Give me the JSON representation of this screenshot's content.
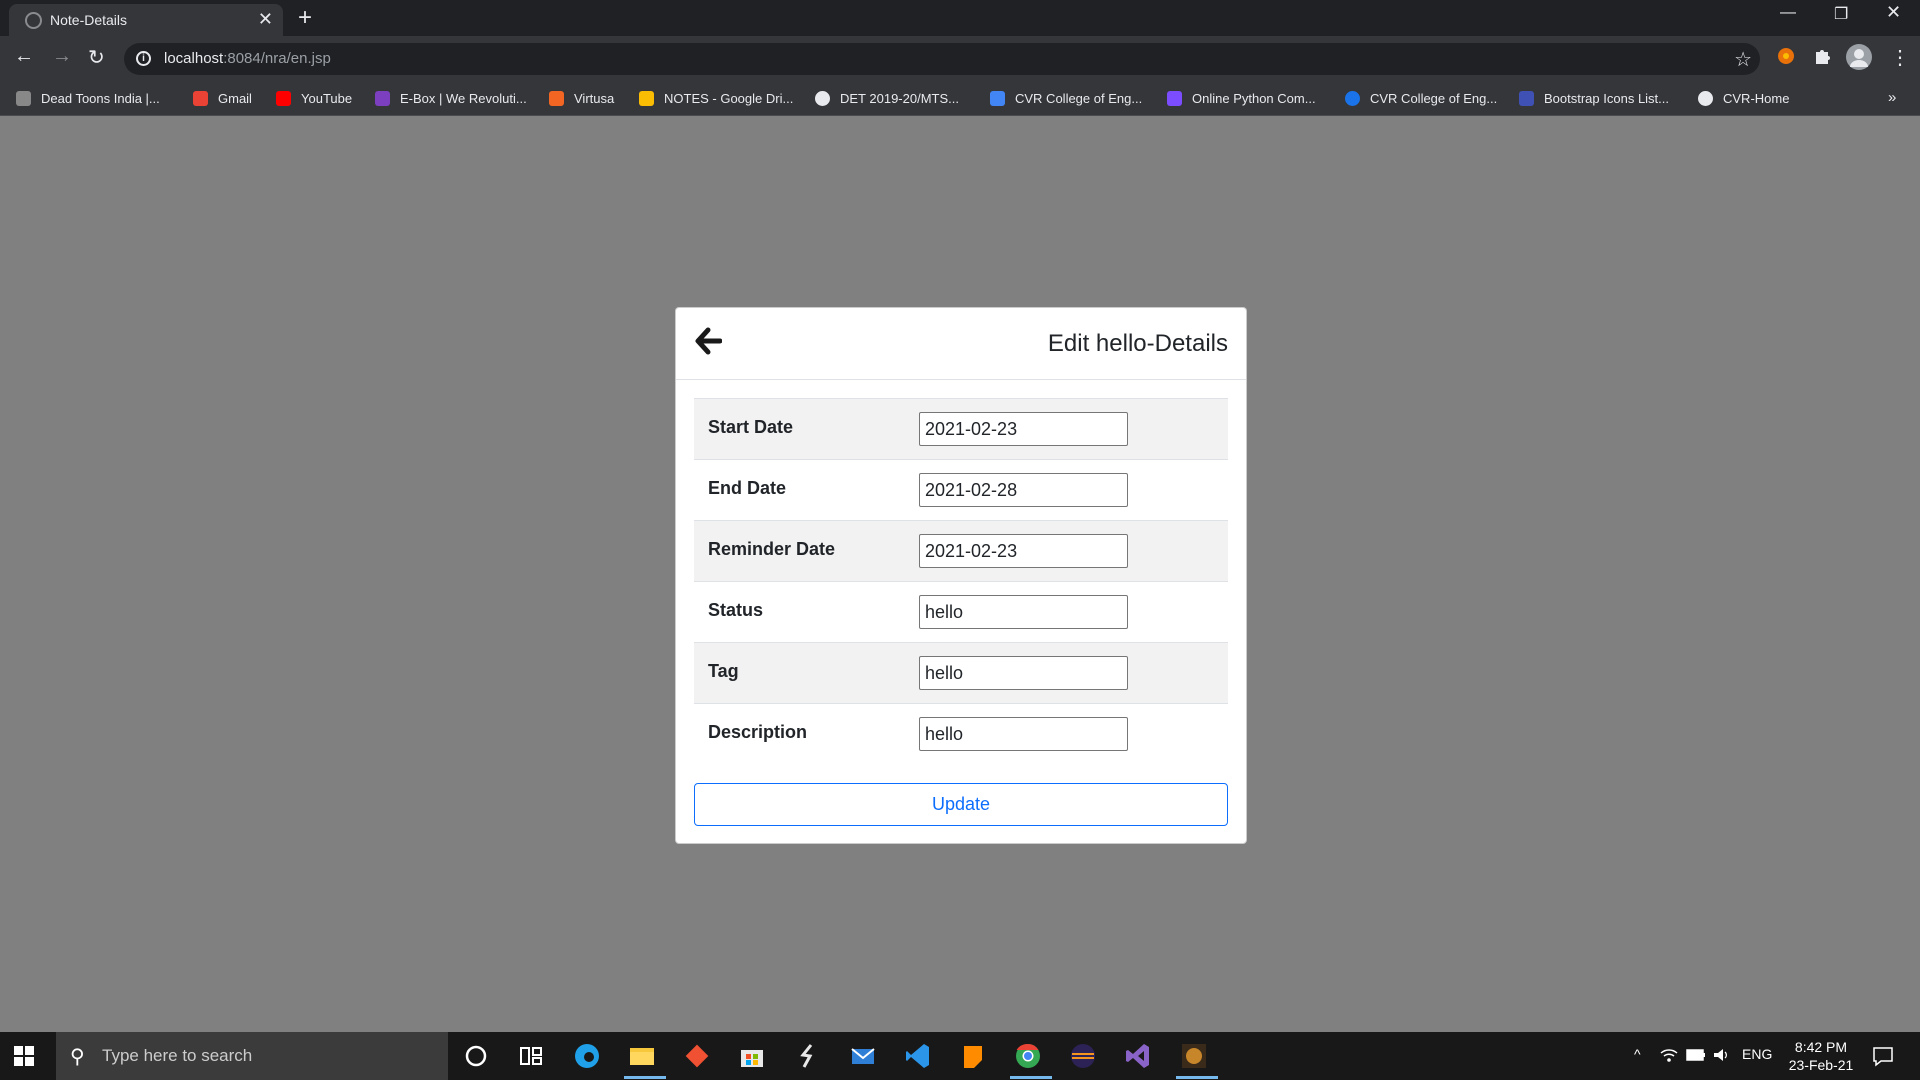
{
  "browser": {
    "tab_title": "Note-Details",
    "url_host": "localhost",
    "url_path": ":8084/nra/en.jsp",
    "bookmarks": [
      {
        "label": "Dead Toons India |...",
        "color": "#888888"
      },
      {
        "label": "Gmail",
        "color": "#ea4335"
      },
      {
        "label": "YouTube",
        "color": "#ff0000"
      },
      {
        "label": "E-Box | We Revoluti...",
        "color": "#7b3fbf"
      },
      {
        "label": "Virtusa",
        "color": "#f26522"
      },
      {
        "label": "NOTES - Google Dri...",
        "color": "#fbbc04"
      },
      {
        "label": "DET 2019-20/MTS...",
        "color": "#e8eaed"
      },
      {
        "label": "CVR College of Eng...",
        "color": "#4285f4"
      },
      {
        "label": "Online Python Com...",
        "color": "#7c4dff"
      },
      {
        "label": "CVR College of Eng...",
        "color": "#1a73e8"
      },
      {
        "label": "Bootstrap Icons List...",
        "color": "#3f51b5"
      },
      {
        "label": "CVR-Home",
        "color": "#e8eaed"
      }
    ],
    "more_bookmarks": "»"
  },
  "page": {
    "modal_title": "Edit hello-Details",
    "fields": [
      {
        "label": "Start Date",
        "value": "2021-02-23"
      },
      {
        "label": "End Date",
        "value": "2021-02-28"
      },
      {
        "label": "Reminder Date",
        "value": "2021-02-23"
      },
      {
        "label": "Status",
        "value": "hello"
      },
      {
        "label": "Tag",
        "value": "hello"
      },
      {
        "label": "Description",
        "value": "hello"
      }
    ],
    "update_label": "Update"
  },
  "taskbar": {
    "search_placeholder": "Type here to search",
    "language": "ENG",
    "time": "8:42 PM",
    "date": "23-Feb-21",
    "pinned": [
      {
        "name": "cortana-icon",
        "color": "#ffffff"
      },
      {
        "name": "task-view-icon",
        "color": "#ffffff"
      },
      {
        "name": "edge-icon",
        "color": "#1fa0e8"
      },
      {
        "name": "file-explorer-icon",
        "color": "#f8c83c"
      },
      {
        "name": "git-icon",
        "color": "#f05133"
      },
      {
        "name": "store-icon",
        "color": "#3d8ee8"
      },
      {
        "name": "sublime-icon",
        "color": "#e8e8e8"
      },
      {
        "name": "mail-icon",
        "color": "#2f7fd6"
      },
      {
        "name": "vscode-icon",
        "color": "#2b95e9"
      },
      {
        "name": "sticky-notes-icon",
        "color": "#ff8c00"
      },
      {
        "name": "chrome-icon",
        "color": "#34a853"
      },
      {
        "name": "eclipse-icon",
        "color": "#2c2255"
      },
      {
        "name": "visual-studio-icon",
        "color": "#8a63c8"
      },
      {
        "name": "app-icon",
        "color": "#c8862a"
      }
    ]
  }
}
